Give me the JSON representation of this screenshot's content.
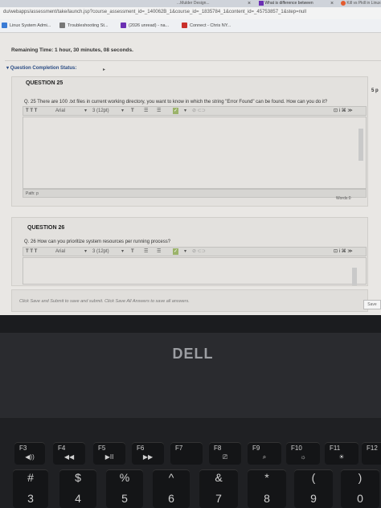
{
  "browser": {
    "tabs": {
      "left_partial": "...Mulder Design...",
      "what_tab": "What is difference between",
      "close_glyph": "×",
      "right_tab": "Kill vs Pkill in Linux"
    },
    "url": "du/webapps/assessment/take/launch.jsp?course_assessment_id=_140062B_1&course_id=_1835784_1&content_id=_45753857_1&step=null",
    "bookmarks": [
      {
        "label": "Linux System Admi...",
        "color": "#3a7bd5"
      },
      {
        "label": "Troubleshooting St...",
        "color": "#777777"
      },
      {
        "label": "(2026 unread) - na...",
        "color": "#6b2fb3"
      },
      {
        "label": "Connect - Chris NY...",
        "color": "#c9302c"
      }
    ]
  },
  "assessment": {
    "remaining_time": "Remaining Time: 1 hour, 30 minutes, 08 seconds.",
    "completion_status": "Question Completion Status:",
    "points_partial": "5 p",
    "q25": {
      "title": "QUESTION 25",
      "text": "Q. 25 There are 100 .txt files in current working directory, you want to know in which the string \"Error Found\" can be found. How can you do it?",
      "path": "Path: p",
      "words": "Words:0"
    },
    "q26": {
      "title": "QUESTION 26",
      "text": "Q. 26 How can you prioritize system resources per running process?"
    },
    "toolbar": {
      "font_styles": "T T T",
      "font": "Arial",
      "size": "3 (12pt)",
      "text_color": "T",
      "list1": "☰",
      "list2": "☰"
    },
    "footer_note": "Click Save and Submit to save and submit. Click Save All Answers to save all answers.",
    "save_all": "Save"
  },
  "laptop": {
    "brand": "DELL",
    "fkeys": [
      {
        "label": "F3",
        "sub": "◀))"
      },
      {
        "label": "F4",
        "sub": "◀◀"
      },
      {
        "label": "F5",
        "sub": "▶II"
      },
      {
        "label": "F6",
        "sub": "▶▶"
      },
      {
        "label": "F7",
        "sub": ""
      },
      {
        "label": "F8",
        "sub": "⎚"
      },
      {
        "label": "F9",
        "sub": "⌕"
      },
      {
        "label": "F10",
        "sub": "☼"
      },
      {
        "label": "F11",
        "sub": "☀"
      },
      {
        "label": "F12",
        "sub": ""
      }
    ],
    "numkeys": [
      {
        "top": "#",
        "bot": "3"
      },
      {
        "top": "$",
        "bot": "4"
      },
      {
        "top": "%",
        "bot": "5"
      },
      {
        "top": "^",
        "bot": "6"
      },
      {
        "top": "&",
        "bot": "7"
      },
      {
        "top": "*",
        "bot": "8"
      },
      {
        "top": "(",
        "bot": "9"
      },
      {
        "top": ")",
        "bot": "0"
      }
    ]
  }
}
